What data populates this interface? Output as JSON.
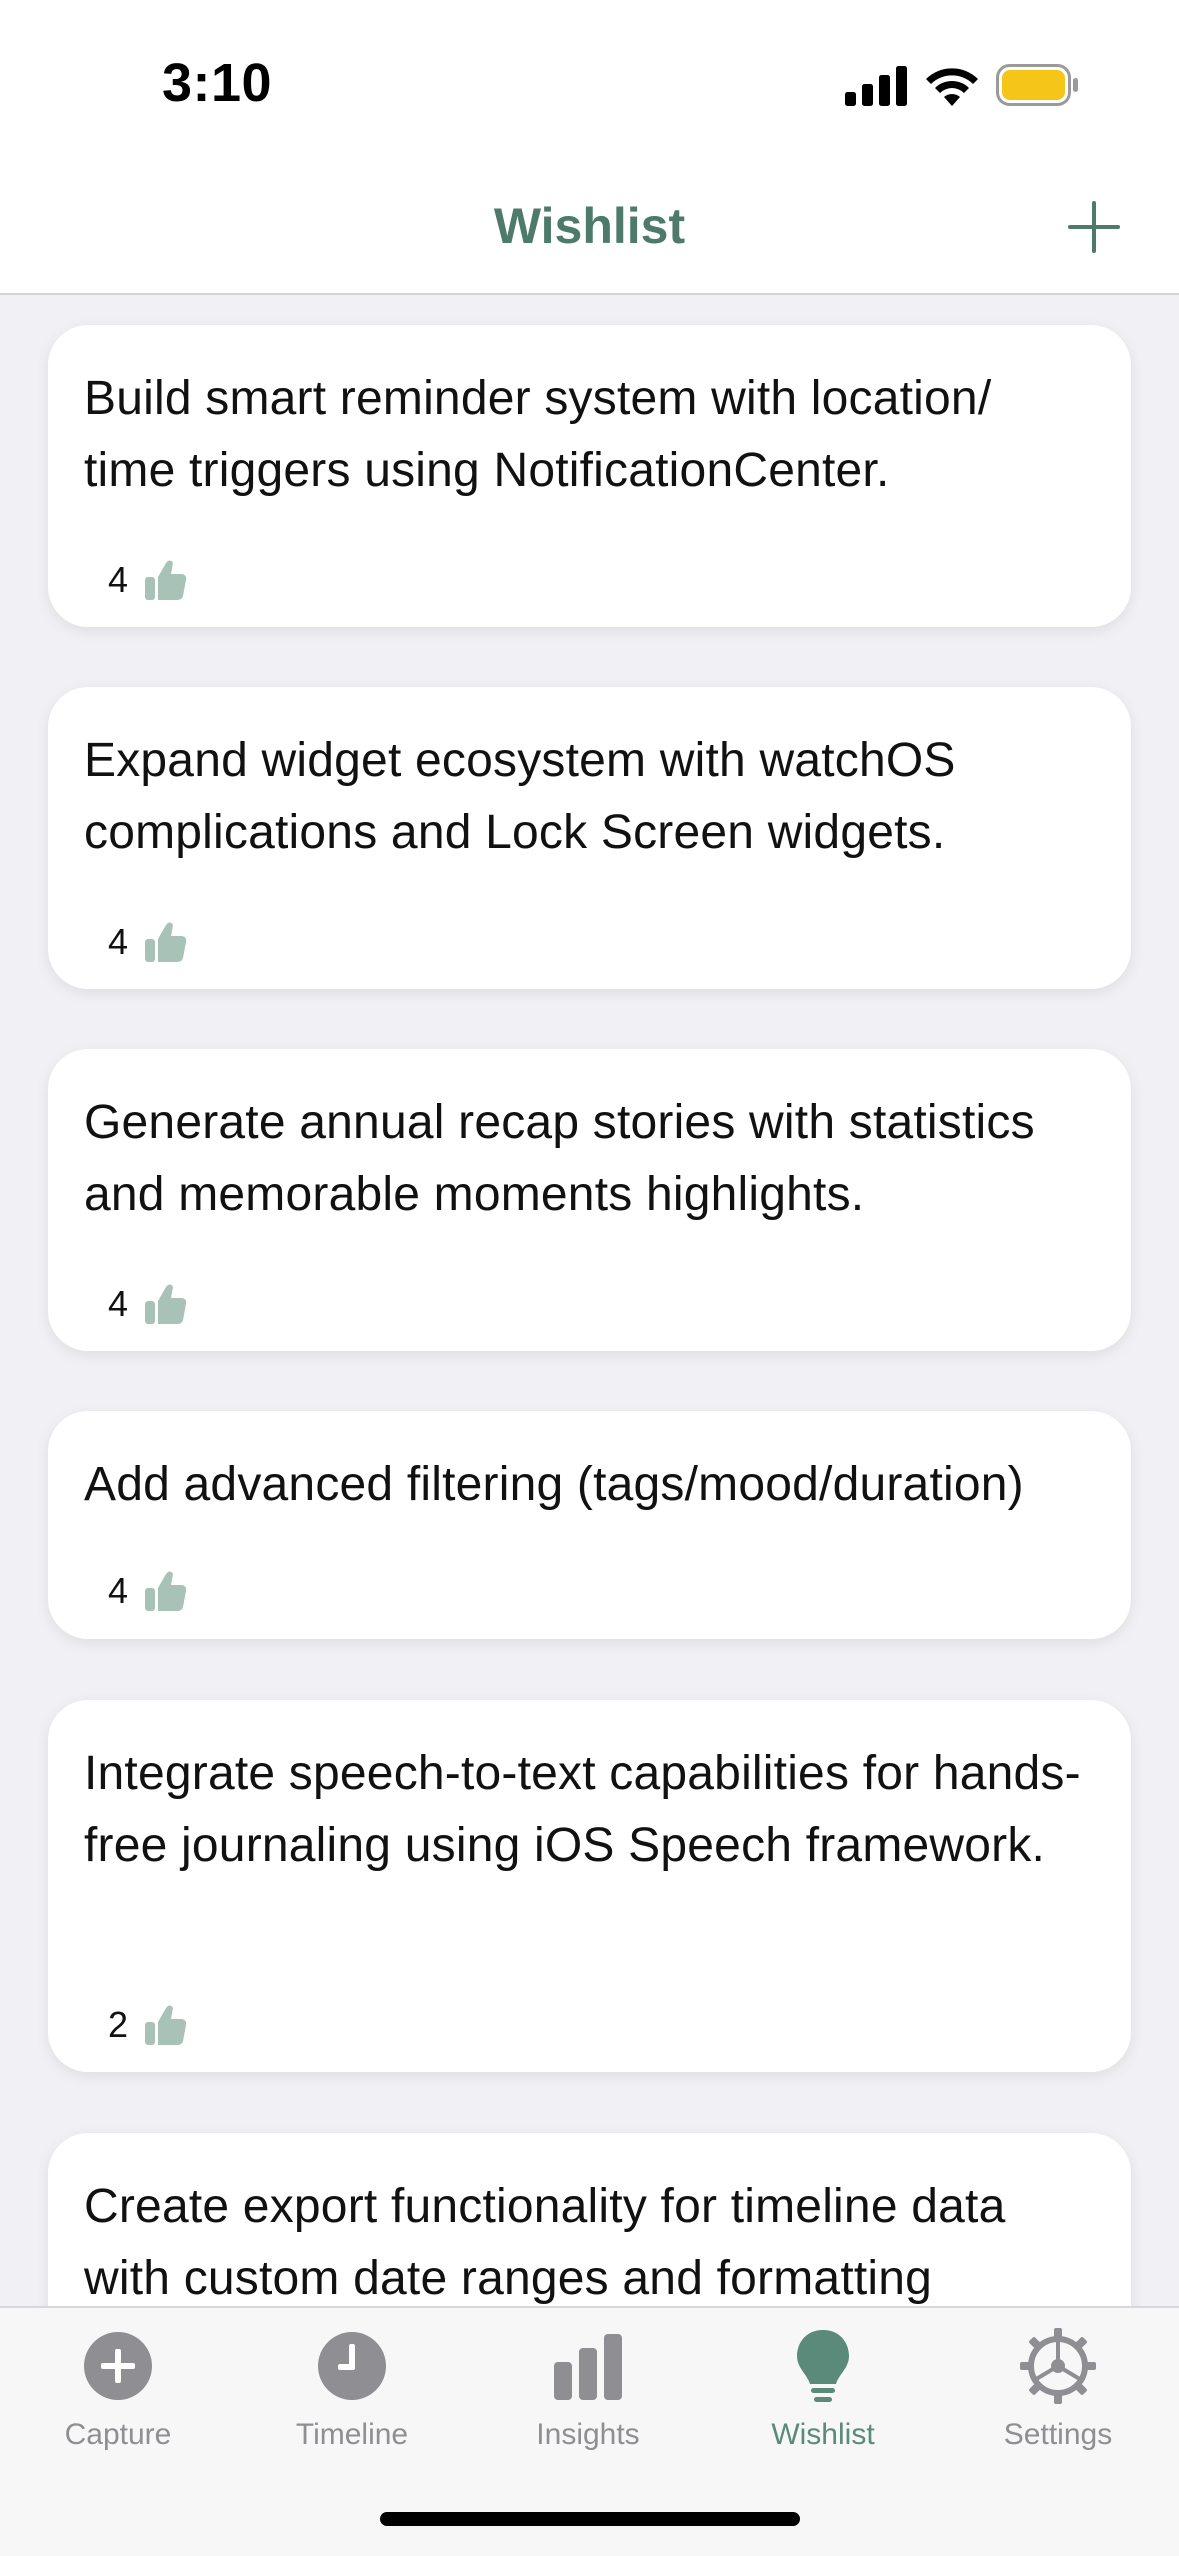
{
  "status_bar": {
    "time": "3:10",
    "battery_color": "#f5c518"
  },
  "nav": {
    "title": "Wishlist",
    "add_icon": "plus-icon",
    "accent": "#4e7a6b"
  },
  "wishlist": {
    "items": [
      {
        "text": "Build smart reminder system with location/ time triggers using NotificationCenter.",
        "votes": "4"
      },
      {
        "text": "Expand widget ecosystem with watchOS complications and Lock Screen widgets.",
        "votes": "4"
      },
      {
        "text": "Generate annual recap stories with statistics and memorable moments highlights.",
        "votes": "4"
      },
      {
        "text": "Add advanced filtering (tags/mood/duration)",
        "votes": "4"
      },
      {
        "text": "Integrate speech-to-text capabilities for hands-free journaling using iOS Speech framework.",
        "votes": "2"
      },
      {
        "text": "Create export functionality for timeline data with custom date ranges and formatting",
        "votes": ""
      }
    ],
    "vote_icon": "thumbs-up-icon",
    "vote_icon_color": "#a9c2b8"
  },
  "tab_bar": {
    "tabs": [
      {
        "label": "Capture",
        "icon": "plus-circle-icon",
        "active": false
      },
      {
        "label": "Timeline",
        "icon": "clock-icon",
        "active": false
      },
      {
        "label": "Insights",
        "icon": "bar-chart-icon",
        "active": false
      },
      {
        "label": "Wishlist",
        "icon": "lightbulb-icon",
        "active": true
      },
      {
        "label": "Settings",
        "icon": "gear-icon",
        "active": false
      }
    ],
    "active_color": "#5a8a7a",
    "inactive_color": "#8e8e93"
  }
}
